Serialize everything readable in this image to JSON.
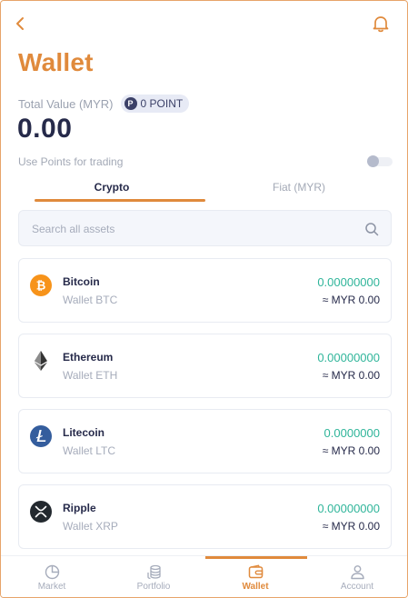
{
  "header": {
    "title": "Wallet"
  },
  "summary": {
    "total_label": "Total Value (MYR)",
    "points_icon_letter": "P",
    "points_text": "0 POINT",
    "total_value": "0.00",
    "use_points_label": "Use Points for trading",
    "use_points_enabled": false
  },
  "tabs": [
    {
      "label": "Crypto",
      "active": true
    },
    {
      "label": "Fiat (MYR)",
      "active": false
    }
  ],
  "search": {
    "placeholder": "Search all assets"
  },
  "assets": [
    {
      "name": "Bitcoin",
      "wallet": "Wallet BTC",
      "amount": "0.00000000",
      "fiat": "≈ MYR 0.00",
      "icon": "bitcoin-icon",
      "color": "#f7931a"
    },
    {
      "name": "Ethereum",
      "wallet": "Wallet ETH",
      "amount": "0.00000000",
      "fiat": "≈ MYR 0.00",
      "icon": "ethereum-icon",
      "color": "#3c3c3d"
    },
    {
      "name": "Litecoin",
      "wallet": "Wallet LTC",
      "amount": "0.0000000",
      "fiat": "≈ MYR 0.00",
      "icon": "litecoin-icon",
      "color": "#345d9d"
    },
    {
      "name": "Ripple",
      "wallet": "Wallet XRP",
      "amount": "0.00000000",
      "fiat": "≈ MYR 0.00",
      "icon": "ripple-icon",
      "color": "#23292f"
    }
  ],
  "nav": [
    {
      "label": "Market",
      "icon": "pie-chart-icon",
      "active": false
    },
    {
      "label": "Portfolio",
      "icon": "coins-icon",
      "active": false
    },
    {
      "label": "Wallet",
      "icon": "wallet-icon",
      "active": true
    },
    {
      "label": "Account",
      "icon": "user-icon",
      "active": false
    }
  ],
  "colors": {
    "accent": "#e08a3c",
    "positive": "#2fb59a",
    "text_dark": "#262a4a",
    "text_muted": "#a6acbb"
  }
}
